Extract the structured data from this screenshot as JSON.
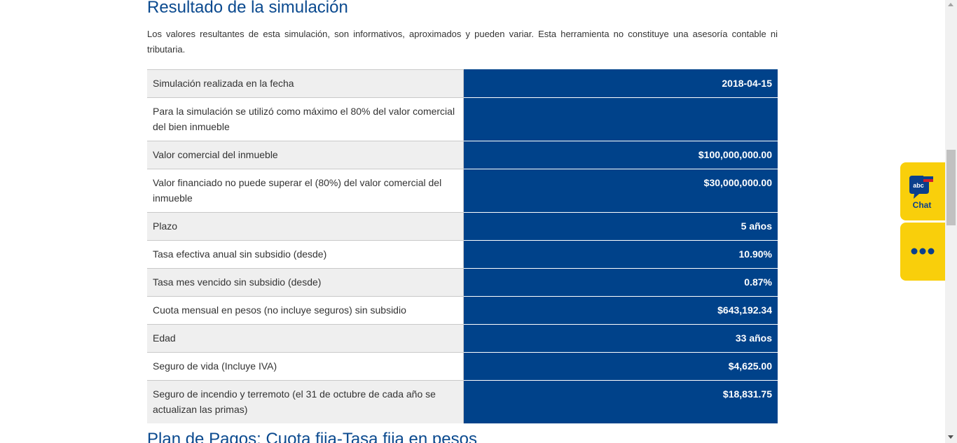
{
  "header": {
    "title": "Resultado de la simulación",
    "intro": "Los valores resultantes de esta simulación, son informativos, aproximados y pueden variar. Esta herramienta no constituye una asesoría contable ni tributaria."
  },
  "results": [
    {
      "label": "Simulación realizada en la fecha",
      "value": "2018-04-15"
    },
    {
      "label": "Para la simulación se utilizó como máximo el 80% del valor comercial del bien inmueble",
      "value": ""
    },
    {
      "label": "Valor comercial del inmueble",
      "value": "$100,000,000.00"
    },
    {
      "label": "Valor financiado no puede superar el (80%) del valor comercial del inmueble",
      "value": "$30,000,000.00"
    },
    {
      "label": "Plazo",
      "value": "5 años"
    },
    {
      "label": "Tasa efectiva anual sin subsidio (desde)",
      "value": "10.90%"
    },
    {
      "label": "Tasa mes vencido sin subsidio (desde)",
      "value": "0.87%"
    },
    {
      "label": "Cuota mensual en pesos (no incluye seguros) sin subsidio",
      "value": "$643,192.34"
    },
    {
      "label": "Edad",
      "value": "33 años"
    },
    {
      "label": "Seguro de vida (Incluye IVA)",
      "value": "$4,625.00"
    },
    {
      "label": "Seguro de incendio y terremoto (el 31 de octubre de cada año se actualizan las primas)",
      "value": "$18,831.75"
    }
  ],
  "next_section": {
    "title": "Plan de Pagos: Cuota fija-Tasa fija en pesos"
  },
  "widget": {
    "chat_label": "Chat",
    "chat_icon": "abc-chat-bubble-icon",
    "chat_icon_text": "abc",
    "more_icon": "more-dots-icon"
  },
  "colors": {
    "accent_blue": "#00428a",
    "title_blue": "#0b4a8f",
    "widget_yellow": "#f9cf0b"
  }
}
